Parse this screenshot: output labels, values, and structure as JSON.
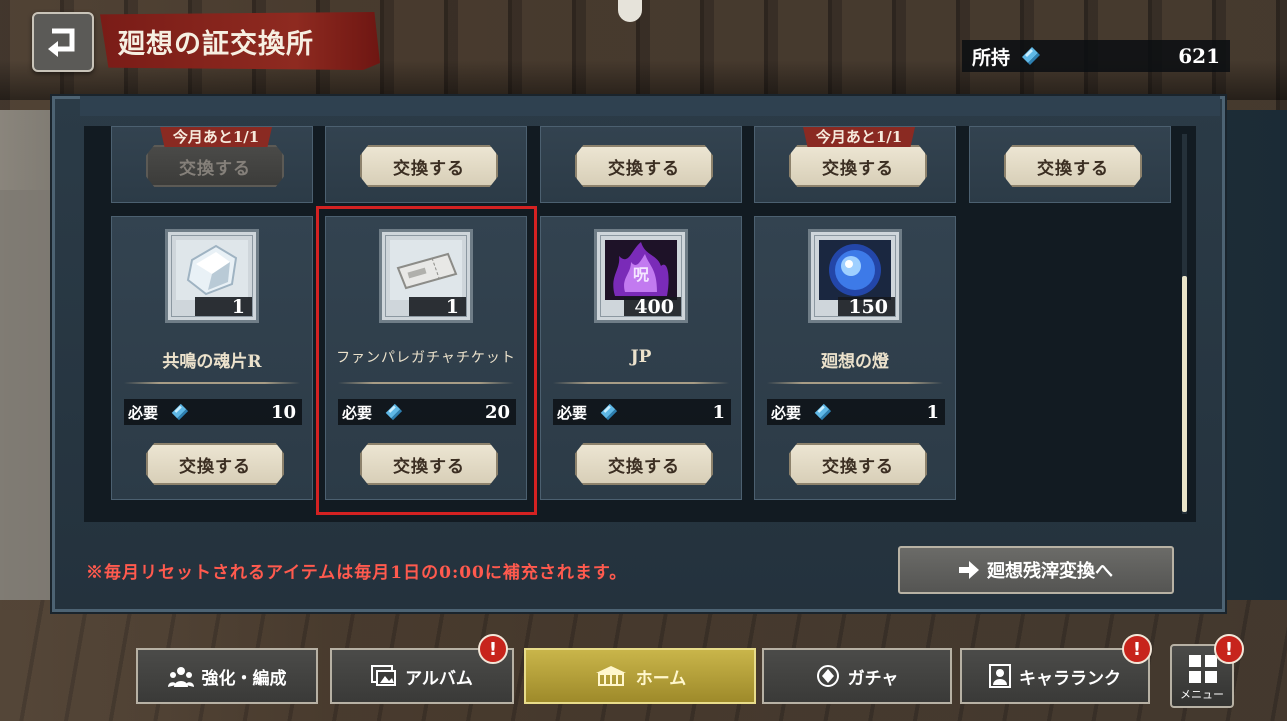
{
  "header": {
    "title": "廻想の証交換所",
    "owned_label": "所持",
    "owned_value": "621",
    "back_icon": "back-arrow-icon"
  },
  "top_row": [
    {
      "limit": "今月あと1/1",
      "button": "交換する",
      "disabled": true
    },
    {
      "limit": "",
      "button": "交換する",
      "disabled": false
    },
    {
      "limit": "",
      "button": "交換する",
      "disabled": false
    },
    {
      "limit": "今月あと1/1",
      "button": "交換する",
      "disabled": false
    },
    {
      "limit": "",
      "button": "交換する",
      "disabled": false
    }
  ],
  "items": [
    {
      "name": "共鳴の魂片R",
      "qty": "1",
      "req_label": "必要",
      "req_value": "10",
      "button": "交換する",
      "icon": "crystal-shard-icon"
    },
    {
      "name": "ファンパレガチャチケット",
      "qty": "1",
      "req_label": "必要",
      "req_value": "20",
      "button": "交換する",
      "icon": "gacha-ticket-icon"
    },
    {
      "name": "JP",
      "qty": "400",
      "req_label": "必要",
      "req_value": "1",
      "button": "交換する",
      "icon": "jp-flame-icon"
    },
    {
      "name": "廻想の燈",
      "qty": "150",
      "req_label": "必要",
      "req_value": "1",
      "button": "交換する",
      "icon": "blue-orb-icon"
    }
  ],
  "notice": "※毎月リセットされるアイテムは毎月1日の0:00に補充されます。",
  "convert_button": "廻想残滓変換へ",
  "nav": {
    "enhance": "強化・編成",
    "album": "アルバム",
    "home": "ホーム",
    "gacha": "ガチャ",
    "chara_rank": "キャラランク",
    "menu": "メニュー",
    "badge": "!"
  },
  "colors": {
    "accent_red": "#d42222",
    "title_banner": "#8e2a20",
    "home_active": "#c9b54a",
    "notice_red": "#ff5a4e"
  }
}
